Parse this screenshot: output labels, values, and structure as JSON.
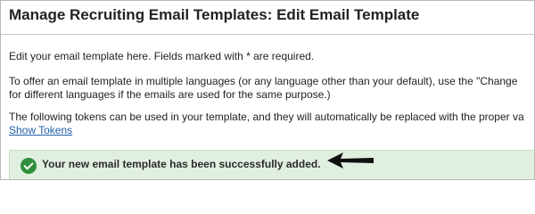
{
  "page": {
    "title": "Manage Recruiting Email Templates: Edit Email Template"
  },
  "intro": {
    "line1": "Edit your email template here. Fields marked with * are required.",
    "line2": "To offer an email template in multiple languages (or any language other than your default), use the \"Change",
    "line3": "for different languages if the emails are used for the same purpose.)",
    "line4": "The following tokens can be used in your template, and they will automatically be replaced with the proper va",
    "show_tokens_link": "Show Tokens"
  },
  "success": {
    "message": "Your new email template has been successfully added.",
    "icon": "check-circle-icon",
    "color": "#2f8f3a",
    "background": "#e1efe0"
  },
  "annotation": {
    "icon": "pointer-arrow-icon"
  }
}
